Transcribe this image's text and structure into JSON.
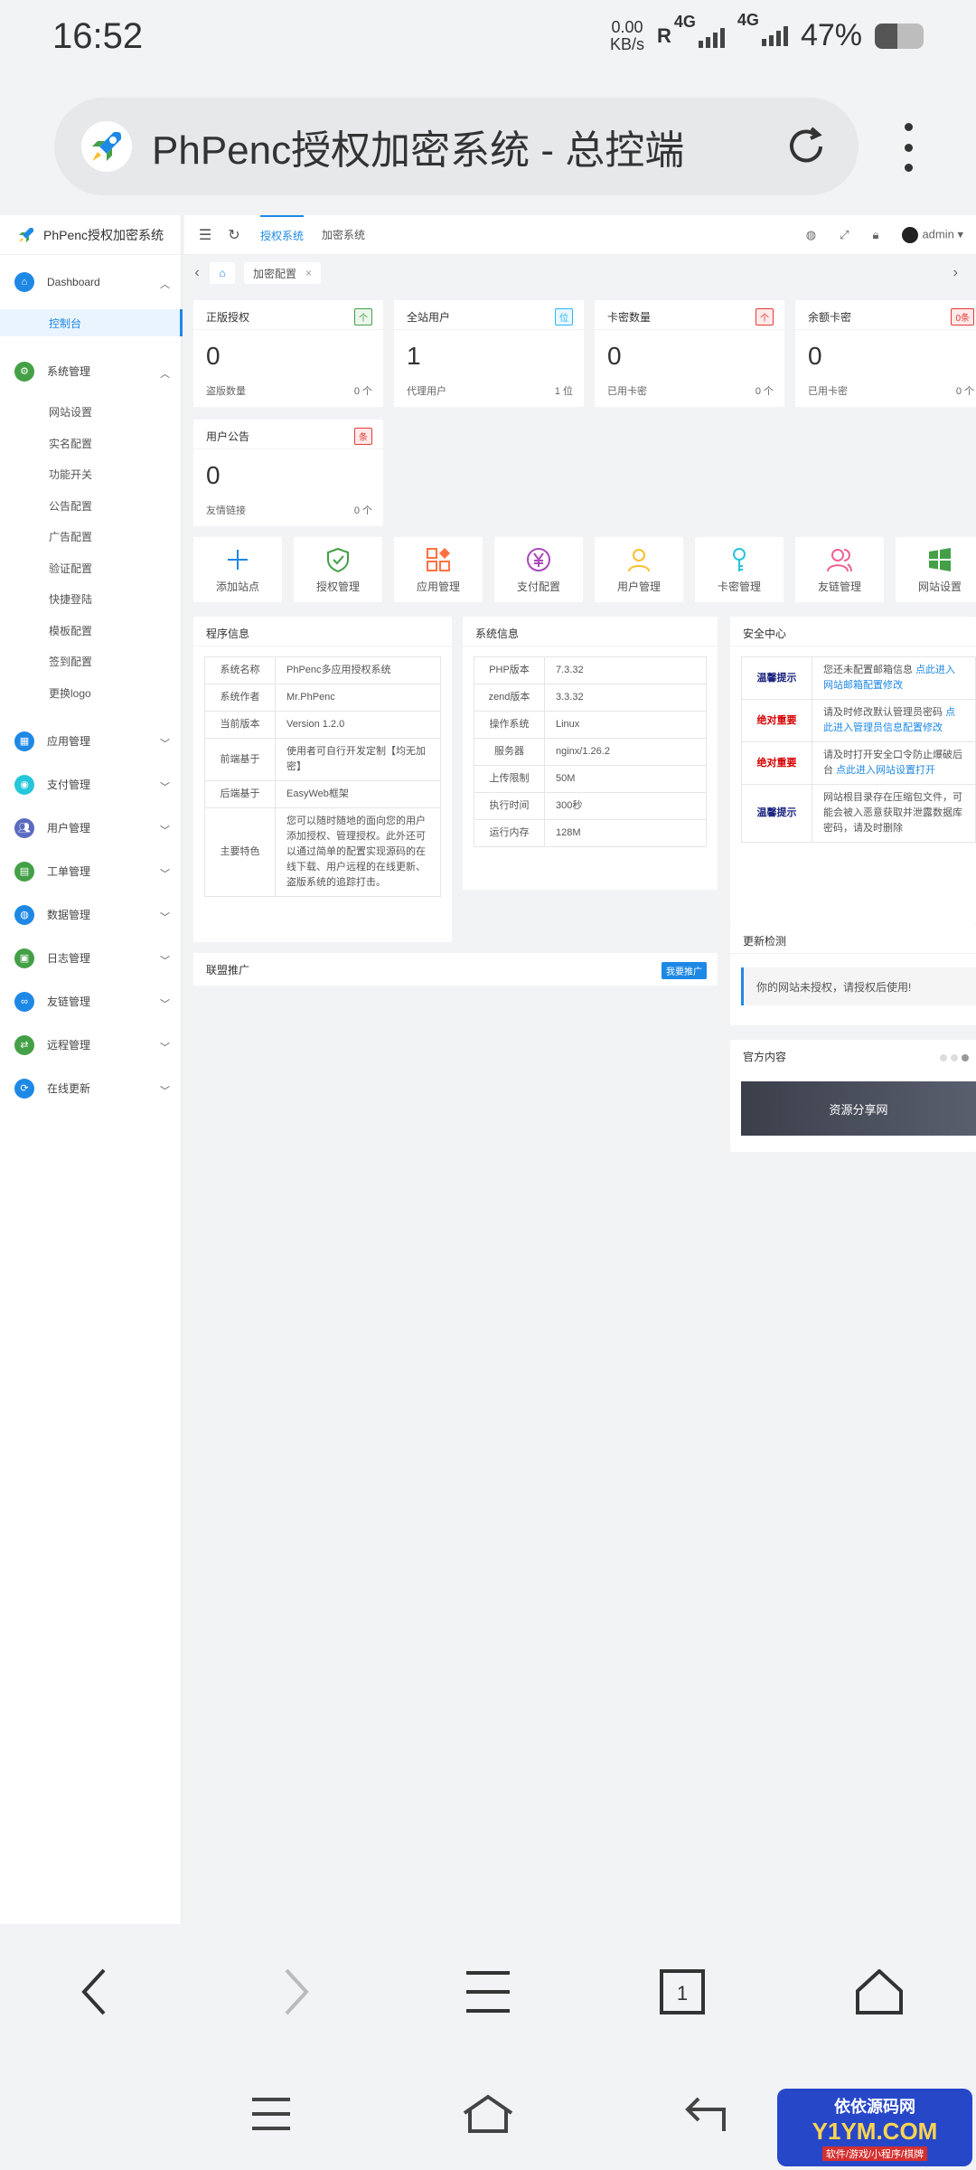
{
  "status_bar": {
    "time": "16:52",
    "speed_value": "0.00",
    "speed_unit": "KB/s",
    "roaming": "R",
    "network1": "4G",
    "network2": "4G",
    "battery_text": "47%",
    "battery_level": 0.47
  },
  "browser": {
    "page_title": "PhPenc授权加密系统 - 总控端"
  },
  "sidebar": {
    "brand": "PhPenc授权加密系统",
    "groups": [
      {
        "label": "Dashboard",
        "color": "#1e88e5",
        "icon": "home-icon",
        "expanded": true,
        "items": [
          {
            "label": "控制台",
            "active": true
          }
        ]
      },
      {
        "label": "系统管理",
        "color": "#43a047",
        "icon": "gear-icon",
        "expanded": true,
        "items": [
          {
            "label": "网站设置"
          },
          {
            "label": "实名配置"
          },
          {
            "label": "功能开关"
          },
          {
            "label": "公告配置"
          },
          {
            "label": "广告配置"
          },
          {
            "label": "验证配置"
          },
          {
            "label": "快捷登陆"
          },
          {
            "label": "模板配置"
          },
          {
            "label": "签到配置"
          },
          {
            "label": "更换logo"
          }
        ]
      },
      {
        "label": "应用管理",
        "color": "#1e88e5",
        "icon": "app-icon"
      },
      {
        "label": "支付管理",
        "color": "#26c6da",
        "icon": "pay-icon"
      },
      {
        "label": "用户管理",
        "color": "#5c6bc0",
        "icon": "users-icon"
      },
      {
        "label": "工单管理",
        "color": "#43a047",
        "icon": "ticket-icon"
      },
      {
        "label": "数据管理",
        "color": "#1e88e5",
        "icon": "data-icon"
      },
      {
        "label": "日志管理",
        "color": "#43a047",
        "icon": "log-icon"
      },
      {
        "label": "友链管理",
        "color": "#1e88e5",
        "icon": "link-icon"
      },
      {
        "label": "远程管理",
        "color": "#43a047",
        "icon": "remote-icon"
      },
      {
        "label": "在线更新",
        "color": "#1e88e5",
        "icon": "update-icon"
      }
    ]
  },
  "topbar": {
    "tabs": [
      "授权系统",
      "加密系统"
    ],
    "user": "admin"
  },
  "page_tabs": {
    "current": "加密配置"
  },
  "stats": [
    {
      "title": "正版授权",
      "badge": "个",
      "badge_color": "#43a047",
      "value": "0",
      "sub_label": "盗版数量",
      "sub_value": "0 个"
    },
    {
      "title": "全站用户",
      "badge": "位",
      "badge_color": "#29b6f6",
      "value": "1",
      "sub_label": "代理用户",
      "sub_value": "1 位"
    },
    {
      "title": "卡密数量",
      "badge": "个",
      "badge_color": "#e53935",
      "value": "0",
      "sub_label": "已用卡密",
      "sub_value": "0 个"
    },
    {
      "title": "余额卡密",
      "badge": "0条",
      "badge_color": "#e53935",
      "value": "0",
      "sub_label": "已用卡密",
      "sub_value": "0 个"
    },
    {
      "title": "用户公告",
      "badge": "条",
      "badge_color": "#e53935",
      "value": "0",
      "sub_label": "友情链接",
      "sub_value": "0 个"
    }
  ],
  "quick_actions": [
    {
      "label": "添加站点",
      "icon": "plus-icon",
      "color": "#1e88e5"
    },
    {
      "label": "授权管理",
      "icon": "shield-check-icon",
      "color": "#43a047"
    },
    {
      "label": "应用管理",
      "icon": "grid-apps-icon",
      "color": "#ff7043"
    },
    {
      "label": "支付配置",
      "icon": "yen-icon",
      "color": "#ab47bc"
    },
    {
      "label": "用户管理",
      "icon": "user-icon",
      "color": "#fbc02d"
    },
    {
      "label": "卡密管理",
      "icon": "key-icon",
      "color": "#26c6da"
    },
    {
      "label": "友链管理",
      "icon": "users-icon",
      "color": "#f06292"
    },
    {
      "label": "网站设置",
      "icon": "windows-icon",
      "color": "#43a047"
    }
  ],
  "program_info": {
    "title": "程序信息",
    "rows": [
      {
        "k": "系统名称",
        "v": "PhPenc多应用授权系统"
      },
      {
        "k": "系统作者",
        "v": "Mr.PhPenc"
      },
      {
        "k": "当前版本",
        "v": "Version 1.2.0"
      },
      {
        "k": "前端基于",
        "v": "使用者可自行开发定制【均无加密】"
      },
      {
        "k": "后端基于",
        "v": "EasyWeb框架"
      },
      {
        "k": "主要特色",
        "v": "您可以随时随地的面向您的用户添加授权、管理授权。此外还可以通过简单的配置实现源码的在线下载、用户远程的在线更新、盗版系统的追踪打击。"
      }
    ]
  },
  "system_info": {
    "title": "系统信息",
    "rows": [
      {
        "k": "PHP版本",
        "v": "7.3.32"
      },
      {
        "k": "zend版本",
        "v": "3.3.32"
      },
      {
        "k": "操作系统",
        "v": "Linux"
      },
      {
        "k": "服务器",
        "v": "nginx/1.26.2"
      },
      {
        "k": "上传限制",
        "v": "50M"
      },
      {
        "k": "执行时间",
        "v": "300秒"
      },
      {
        "k": "运行内存",
        "v": "128M"
      }
    ]
  },
  "security": {
    "title": "安全中心",
    "rows": [
      {
        "tag": "温馨提示",
        "level": "blue",
        "text": "您还未配置邮箱信息 ",
        "link": "点此进入网站邮箱配置修改"
      },
      {
        "tag": "绝对重要",
        "level": "red",
        "text": "请及时修改默认管理员密码 ",
        "link": "点此进入管理员信息配置修改"
      },
      {
        "tag": "绝对重要",
        "level": "red",
        "text": "请及时打开安全口令防止爆破后台 ",
        "link": "点此进入网站设置打开"
      },
      {
        "tag": "温馨提示",
        "level": "blue",
        "text": "网站根目录存在压缩包文件，可能会被入恶意获取并泄露数据库密码，请及时删除",
        "link": ""
      }
    ]
  },
  "promo": {
    "title": "联盟推广",
    "button": "我要推广"
  },
  "update_check": {
    "title": "更新检测",
    "message": "你的网站未授权，请授权后使用!"
  },
  "official": {
    "title": "官方内容",
    "banner": "资源分享网"
  },
  "watermark": {
    "line1": "依依源码网",
    "line2": "Y1YM.COM",
    "line3": "软件/游戏/小程序/棋牌"
  }
}
